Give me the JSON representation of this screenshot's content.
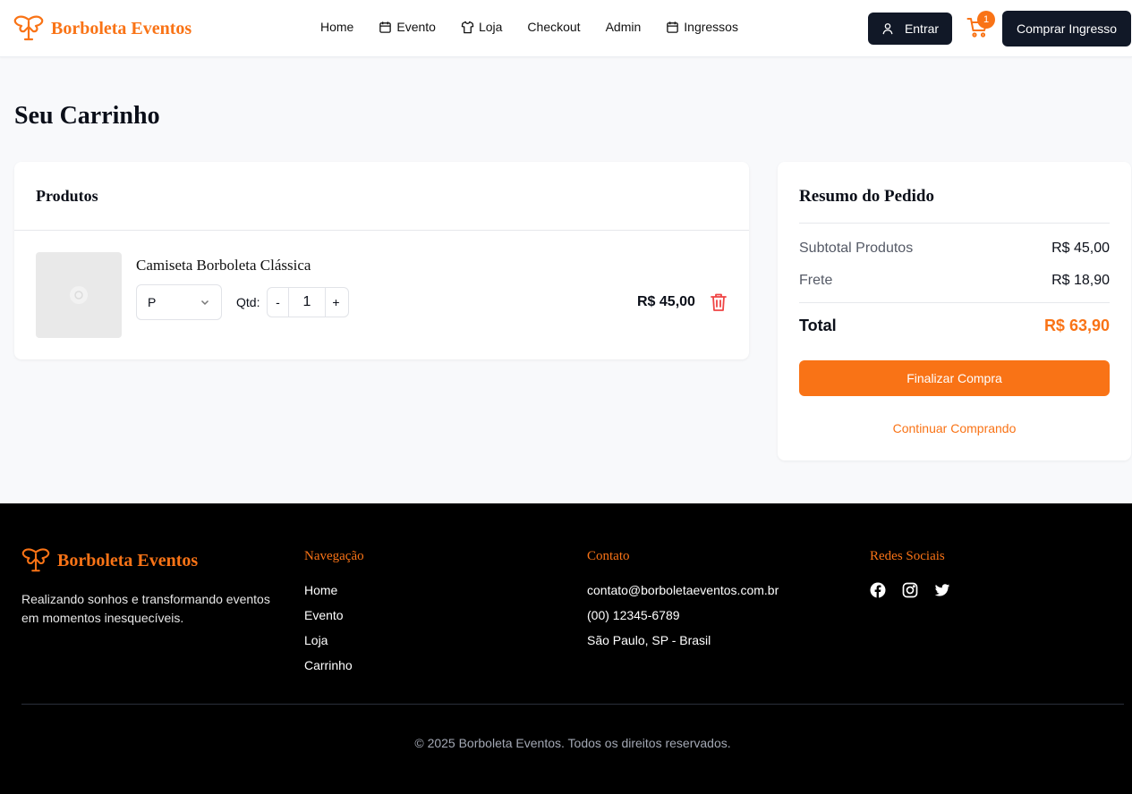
{
  "header": {
    "brand": "Borboleta Eventos",
    "nav": [
      {
        "label": "Home",
        "icon": ""
      },
      {
        "label": "Evento",
        "icon": "calendar-icon"
      },
      {
        "label": "Loja",
        "icon": "shirt-icon"
      },
      {
        "label": "Checkout",
        "icon": ""
      },
      {
        "label": "Admin",
        "icon": ""
      },
      {
        "label": "Ingressos",
        "icon": "calendar-icon"
      }
    ],
    "login_label": "Entrar",
    "cart_count": "1",
    "buy_label": "Comprar Ingresso"
  },
  "main": {
    "title": "Seu Carrinho",
    "products": {
      "heading": "Produtos",
      "items": [
        {
          "name": "Camiseta Borboleta Clássica",
          "size": "P",
          "qty_label": "Qtd:",
          "qty": "1",
          "minus": "-",
          "plus": "+",
          "price": "R$ 45,00"
        }
      ]
    },
    "summary": {
      "title": "Resumo do Pedido",
      "subtotal_label": "Subtotal Produtos",
      "subtotal_value": "R$ 45,00",
      "shipping_label": "Frete",
      "shipping_value": "R$ 18,90",
      "total_label": "Total",
      "total_value": "R$ 63,90",
      "finish_label": "Finalizar Compra",
      "continue_label": "Continuar Comprando"
    }
  },
  "footer": {
    "brand": "Borboleta Eventos",
    "tagline": "Realizando sonhos e transformando eventos em momentos inesquecíveis.",
    "nav_title": "Navegação",
    "nav_links": [
      "Home",
      "Evento",
      "Loja",
      "Carrinho"
    ],
    "contact_title": "Contato",
    "contact": [
      "contato@borboletaeventos.com.br",
      "(00) 12345-6789",
      "São Paulo, SP - Brasil"
    ],
    "social_title": "Redes Sociais",
    "socials": [
      "facebook-icon",
      "instagram-icon",
      "twitter-icon"
    ],
    "copyright": "© 2025 Borboleta Eventos. Todos os direitos reservados."
  },
  "colors": {
    "accent": "#f97316",
    "dark": "#111827",
    "danger": "#ef4444"
  }
}
